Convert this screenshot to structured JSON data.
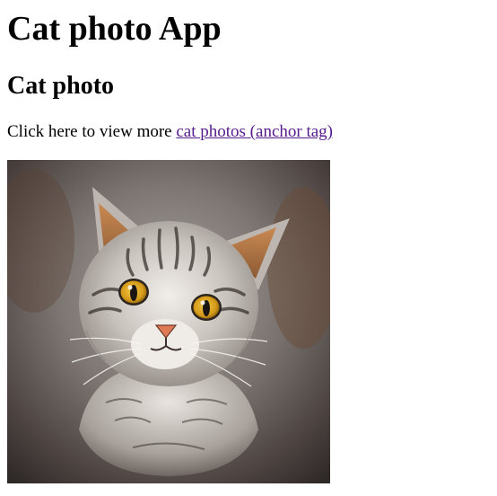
{
  "header": {
    "title": "Cat photo App"
  },
  "main": {
    "subtitle": "Cat photo",
    "intro_text": "Click here to view more ",
    "link_text": "cat photos (anchor tag)",
    "image_alt": "cat photo"
  },
  "colors": {
    "visited_link": "#551a8b",
    "eye": "#d9a21c",
    "nose": "#e07a55"
  }
}
